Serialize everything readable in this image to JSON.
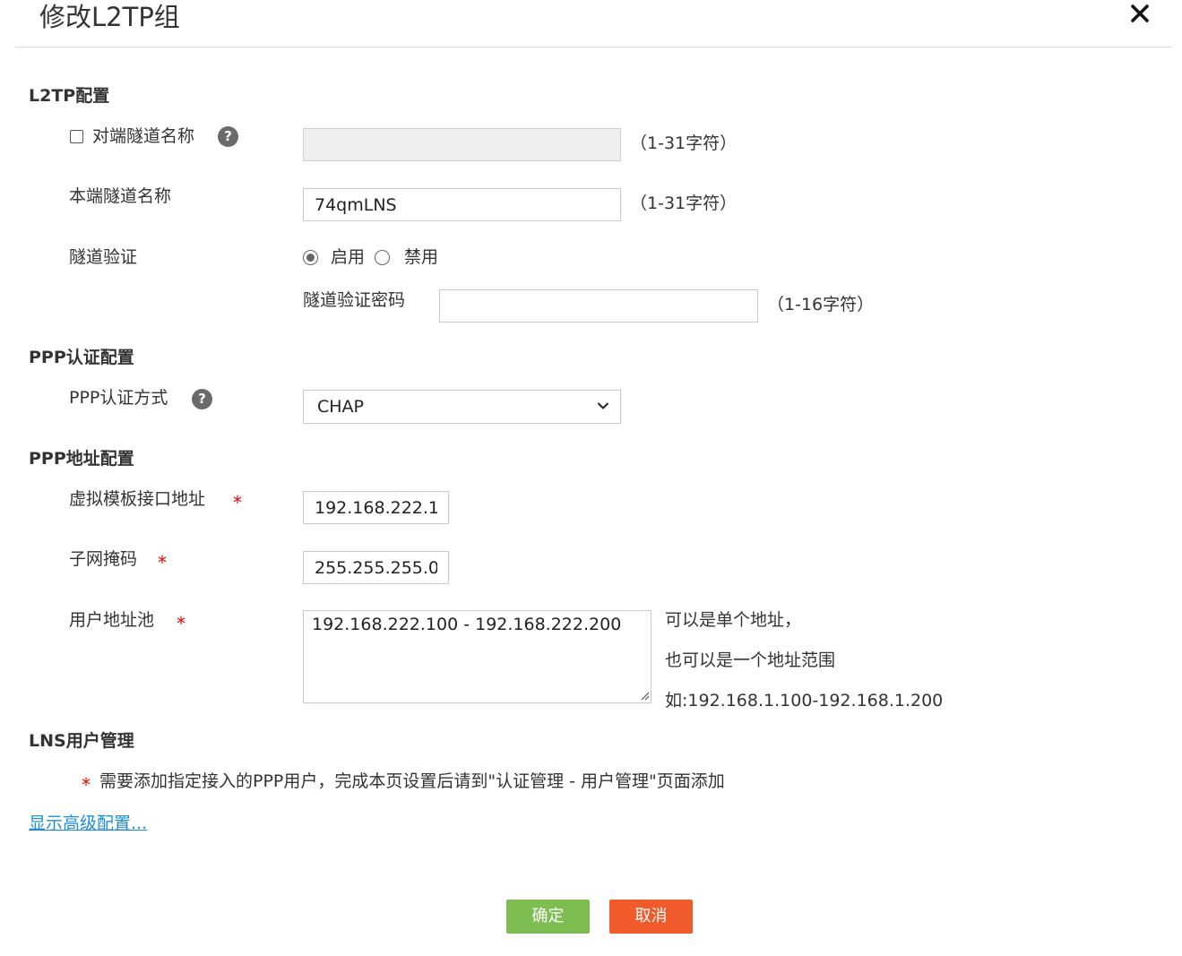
{
  "dialog": {
    "title": "修改L2TP组",
    "close_icon": "close-icon"
  },
  "l2tp": {
    "section_title": "L2TP配置",
    "peer_tunnel": {
      "label": "对端隧道名称",
      "checked": false,
      "value": "",
      "hint": "（1-31字符）",
      "help": "?"
    },
    "local_tunnel": {
      "label": "本端隧道名称",
      "value": "74qmLNS",
      "hint": "（1-31字符）"
    },
    "tunnel_auth": {
      "label": "隧道验证",
      "options": [
        "启用",
        "禁用"
      ],
      "selected": "启用"
    },
    "auth_password": {
      "label": "隧道验证密码",
      "value": "",
      "hint": "（1-16字符）"
    }
  },
  "ppp_auth": {
    "section_title": "PPP认证配置",
    "method": {
      "label": "PPP认证方式",
      "value": "CHAP",
      "help": "?"
    }
  },
  "ppp_address": {
    "section_title": "PPP地址配置",
    "required_mark": "*",
    "vt_address": {
      "label": "虚拟模板接口地址",
      "value": "192.168.222.1"
    },
    "subnet_mask": {
      "label": "子网掩码",
      "value": "255.255.255.0"
    },
    "user_pool": {
      "label": "用户地址池",
      "value": "192.168.222.100 - 192.168.222.200",
      "hints": [
        "可以是单个地址，",
        "也可以是一个地址范围",
        "如:192.168.1.100-192.168.1.200"
      ]
    }
  },
  "lns_user": {
    "section_title": "LNS用户管理",
    "note": "需要添加指定接入的PPP用户，完成本页设置后请到\"认证管理 - 用户管理\"页面添加"
  },
  "advanced_link": "显示高级配置...",
  "buttons": {
    "ok": "确定",
    "cancel": "取消"
  },
  "colors": {
    "ok": "#7dbd52",
    "cancel": "#f15a2b",
    "link": "#1a8fd9",
    "required": "#e60000"
  }
}
